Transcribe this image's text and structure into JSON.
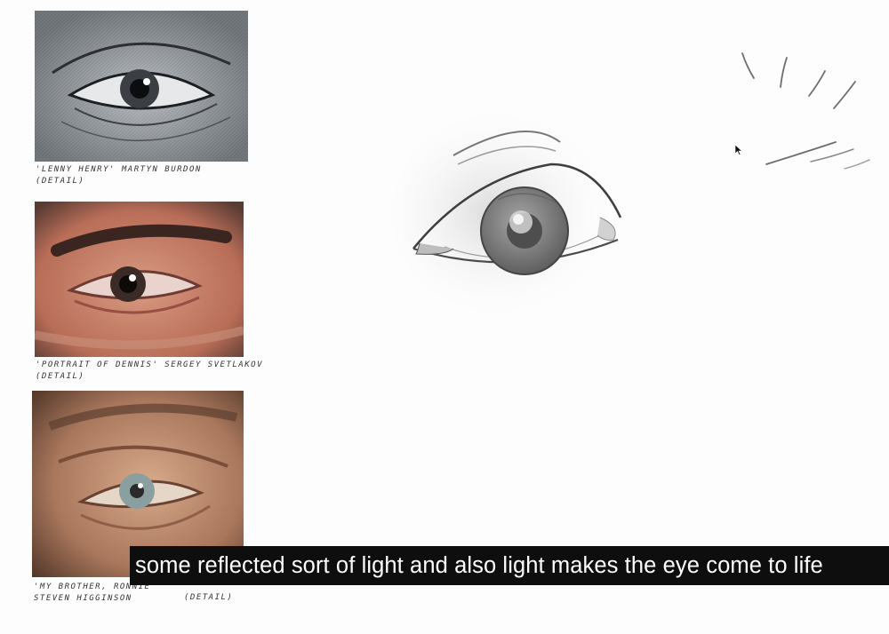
{
  "references": [
    {
      "caption_line1": "'LENNY HENRY' MARTYN BURDON",
      "caption_line2": "(DETAIL)"
    },
    {
      "caption_line1": "'PORTRAIT OF DENNIS' SERGEY SVETLAKOV",
      "caption_line2": "(DETAIL)"
    },
    {
      "caption_line1": "'MY BROTHER, RONNIE'",
      "caption_line2": "STEVEN HIGGINSON",
      "caption_detail": "(DETAIL)"
    }
  ],
  "subtitle": "some reflected sort of light and also light makes the eye come to life",
  "colors": {
    "subtitle_bg": "#0e0e0e",
    "subtitle_text": "#ffffff",
    "paper": "#fdfdfd"
  }
}
